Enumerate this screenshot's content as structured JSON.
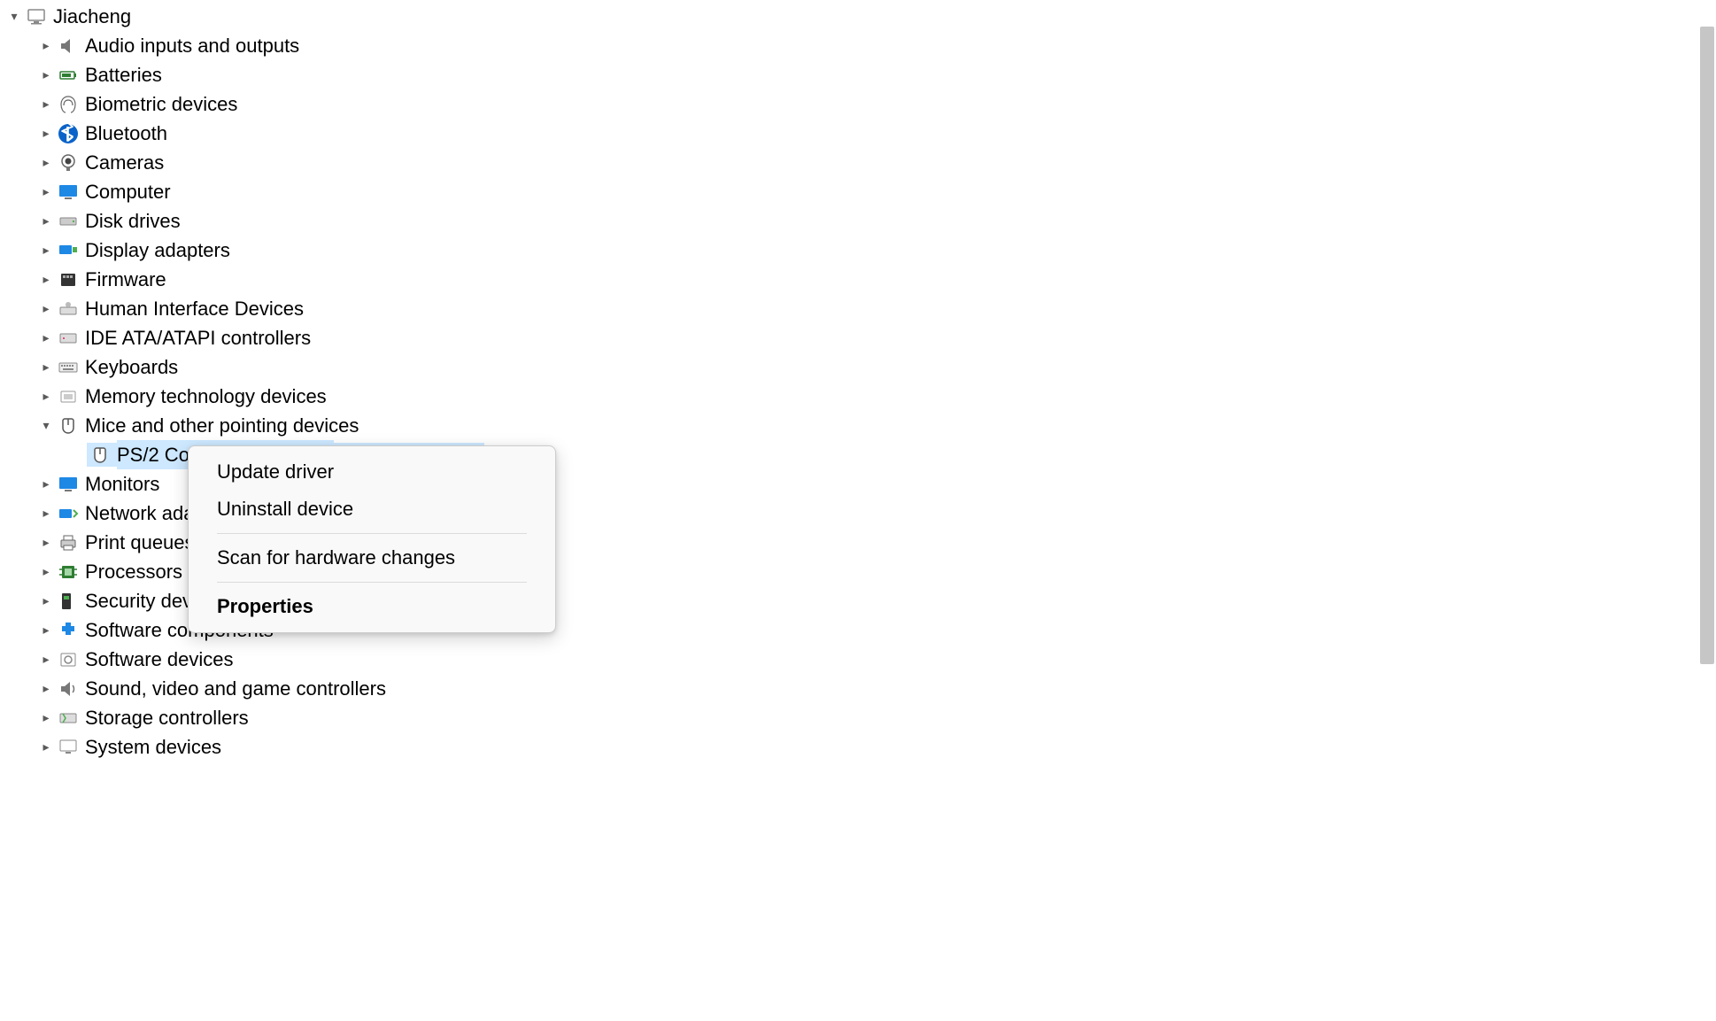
{
  "root": {
    "label": "Jiacheng",
    "icon": "computer-root"
  },
  "categories": [
    {
      "label": "Audio inputs and outputs",
      "icon": "audio"
    },
    {
      "label": "Batteries",
      "icon": "battery"
    },
    {
      "label": "Biometric devices",
      "icon": "biometric"
    },
    {
      "label": "Bluetooth",
      "icon": "bluetooth"
    },
    {
      "label": "Cameras",
      "icon": "camera"
    },
    {
      "label": "Computer",
      "icon": "monitor"
    },
    {
      "label": "Disk drives",
      "icon": "disk"
    },
    {
      "label": "Display adapters",
      "icon": "display-adapter"
    },
    {
      "label": "Firmware",
      "icon": "firmware"
    },
    {
      "label": "Human Interface Devices",
      "icon": "hid"
    },
    {
      "label": "IDE ATA/ATAPI controllers",
      "icon": "ide"
    },
    {
      "label": "Keyboards",
      "icon": "keyboard"
    },
    {
      "label": "Memory technology devices",
      "icon": "memory"
    },
    {
      "label": "Mice and other pointing devices",
      "icon": "mouse",
      "expanded": true,
      "children": [
        {
          "label": "PS/2 Compatible Mouse",
          "icon": "mouse",
          "selected": true
        }
      ]
    },
    {
      "label": "Monitors",
      "icon": "monitor"
    },
    {
      "label": "Network adapters",
      "icon": "network",
      "visible_label": "Network a"
    },
    {
      "label": "Print queues",
      "icon": "printer",
      "visible_label": "Print queue"
    },
    {
      "label": "Processors",
      "icon": "processor"
    },
    {
      "label": "Security devices",
      "icon": "security",
      "visible_label": "Security de"
    },
    {
      "label": "Software components",
      "icon": "software-comp",
      "visible_label": "Software components"
    },
    {
      "label": "Software devices",
      "icon": "software-dev"
    },
    {
      "label": "Sound, video and game controllers",
      "icon": "sound"
    },
    {
      "label": "Storage controllers",
      "icon": "storage"
    },
    {
      "label": "System devices",
      "icon": "system",
      "visible_label": "System devices"
    }
  ],
  "context_menu": {
    "items": [
      {
        "label": "Update driver",
        "type": "item"
      },
      {
        "label": "Uninstall device",
        "type": "item"
      },
      {
        "type": "separator"
      },
      {
        "label": "Scan for hardware changes",
        "type": "item"
      },
      {
        "type": "separator"
      },
      {
        "label": "Properties",
        "type": "item",
        "default": true
      }
    ]
  }
}
